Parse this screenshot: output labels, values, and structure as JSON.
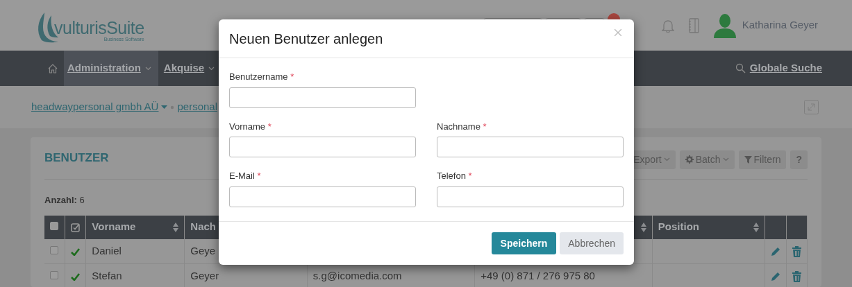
{
  "header": {
    "logo": {
      "name": "vulturisSuite",
      "tagline": "Business Software"
    },
    "user_name": "Katharina Geyer"
  },
  "nav": {
    "items": [
      {
        "label": "Administration",
        "selected": true,
        "dropdown": true
      },
      {
        "label": "Akquise",
        "selected": false,
        "dropdown": true
      }
    ],
    "search_label": "Globale Suche"
  },
  "breadcrumb": [
    {
      "label": "headwaypersonal gmbh AÜ",
      "dropdown": true
    },
    {
      "label": "personal",
      "dropdown": false
    }
  ],
  "panel": {
    "title": "BENUTZER",
    "toolbar": [
      {
        "label": "Export",
        "kind": "dropdown"
      },
      {
        "label": "Batch",
        "kind": "gear"
      },
      {
        "label": "Filtern",
        "kind": "filter"
      },
      {
        "label": "?",
        "kind": "plain"
      }
    ],
    "count_label": "Anzahl:",
    "count": "6"
  },
  "table": {
    "select_all_checked": false,
    "columns": [
      {
        "label": "Vorname",
        "sortable": true
      },
      {
        "label": "Nach",
        "sortable": false
      },
      {},
      {
        "sortable": true
      },
      {
        "label": "Position",
        "sortable": true
      }
    ],
    "rows": [
      {
        "checked": false,
        "active": true,
        "cells": [
          "Daniel",
          "Geye"
        ]
      },
      {
        "checked": false,
        "active": true,
        "cells": [
          "Stefan",
          "Geyer",
          "s.g@icomedia.com",
          "+49 (0) 871 / 276 975 80"
        ]
      }
    ]
  },
  "modal": {
    "title": "Neuen Benutzer anlegen",
    "rows": [
      [
        {
          "label": "Benutzername",
          "required": true,
          "required_mark": "*"
        }
      ],
      [
        {
          "label": "Vorname",
          "required": true,
          "required_mark": "*"
        },
        {
          "label": "Nachname",
          "required": true,
          "required_mark": "*"
        }
      ],
      [
        {
          "label": "E-Mail",
          "required": true,
          "required_mark": "*"
        },
        {
          "label": "Telefon",
          "required": true,
          "required_mark": "*"
        }
      ]
    ],
    "buttons": [
      {
        "label": "Speichern",
        "kind": "primary"
      },
      {
        "label": "Abbrechen",
        "kind": "secondary"
      }
    ]
  }
}
